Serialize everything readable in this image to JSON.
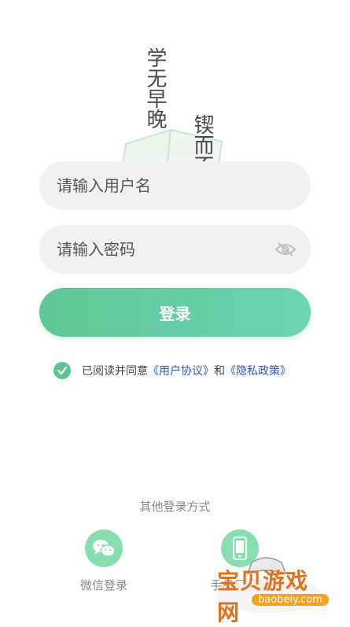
{
  "illustration": {
    "poem_line1": "学无早晚",
    "poem_line2": "锲而不舍"
  },
  "form": {
    "username_placeholder": "请输入用户名",
    "password_placeholder": "请输入密码",
    "login_label": "登录"
  },
  "agreement": {
    "prefix": "已阅读并同意",
    "user_agreement": "《用户协议》",
    "and": "和",
    "privacy_policy": "《隐私政策》",
    "checked": true
  },
  "other_login": {
    "title": "其他登录方式",
    "wechat_label": "微信登录",
    "phone_label": "手机号登录"
  },
  "watermark": {
    "text": "宝贝游戏网",
    "url": "baobeiy.com"
  },
  "colors": {
    "accent": "#5fc693",
    "accent_light": "#87dfb0",
    "link": "#2c59c7",
    "field_bg": "#f1f1f1"
  }
}
